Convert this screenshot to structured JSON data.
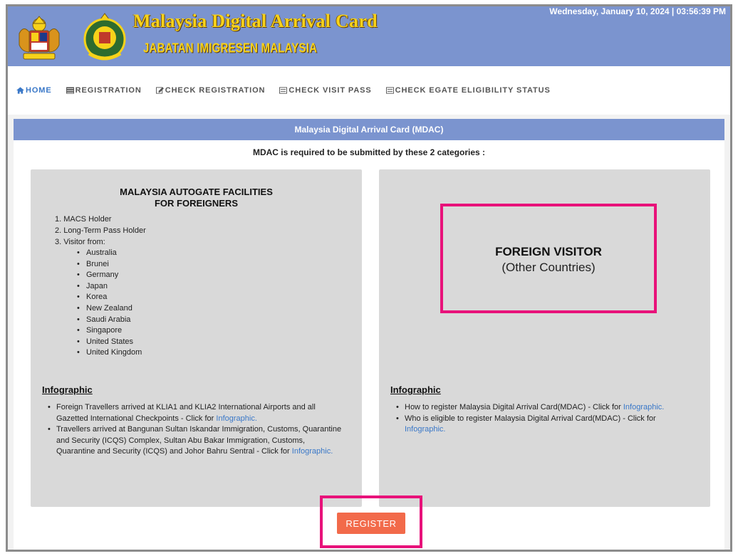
{
  "header": {
    "title": "Malaysia Digital Arrival Card",
    "subtitle": "JABATAN IMIGRESEN MALAYSIA",
    "datetime": "Wednesday, January 10, 2024 | 03:56:39 PM"
  },
  "nav": {
    "items": [
      {
        "label": "HOME",
        "icon": "home-icon"
      },
      {
        "label": "REGISTRATION",
        "icon": "list-icon"
      },
      {
        "label": "CHECK REGISTRATION",
        "icon": "edit-icon"
      },
      {
        "label": "CHECK VISIT PASS",
        "icon": "document-icon"
      },
      {
        "label": "CHECK EGATE ELIGIBILITY STATUS",
        "icon": "document-icon"
      }
    ]
  },
  "panel": {
    "heading": "Malaysia Digital Arrival Card (MDAC)",
    "lead": "MDAC is required to be submitted by these 2 categories :"
  },
  "left_card": {
    "title_line1": "MALAYSIA AUTOGATE FACILITIES",
    "title_line2": "FOR FOREIGNERS",
    "items": [
      "1. MACS Holder",
      "2. Long-Term Pass Holder",
      "3. Visitor from:"
    ],
    "countries": [
      "Australia",
      "Brunei",
      "Germany",
      "Japan",
      "Korea",
      "New Zealand",
      "Saudi Arabia",
      "Singapore",
      "United States",
      "United Kingdom"
    ],
    "infographic_heading": "Infographic",
    "info1_text": "Foreign Travellers arrived at KLIA1 and KLIA2 International Airports and all Gazetted International Checkpoints - Click for ",
    "info1_link": "Infographic.",
    "info2_text": "Travellers arrived at Bangunan Sultan Iskandar Immigration, Customs, Quarantine and Security (ICQS) Complex, Sultan Abu Bakar Immigration, Customs, Quarantine and Security (ICQS) and Johor Bahru Sentral - Click for ",
    "info2_link": "Infographic."
  },
  "right_card": {
    "visitor_title": "FOREIGN VISITOR",
    "visitor_sub": "(Other Countries)",
    "infographic_heading": "Infographic",
    "info1_text": "How to register Malaysia Digital Arrival Card(MDAC) - Click for ",
    "info1_link": "Infographic.",
    "info2_text": "Who is eligible to register Malaysia Digital Arrival Card(MDAC) - Click for ",
    "info2_link": "Infographic."
  },
  "register": {
    "label": "REGISTER"
  },
  "colors": {
    "banner": "#7b94cf",
    "accent_link": "#3a78c8",
    "highlight": "#e8127a",
    "register_button": "#f26a4a",
    "title_gold": "#f7d21a"
  }
}
